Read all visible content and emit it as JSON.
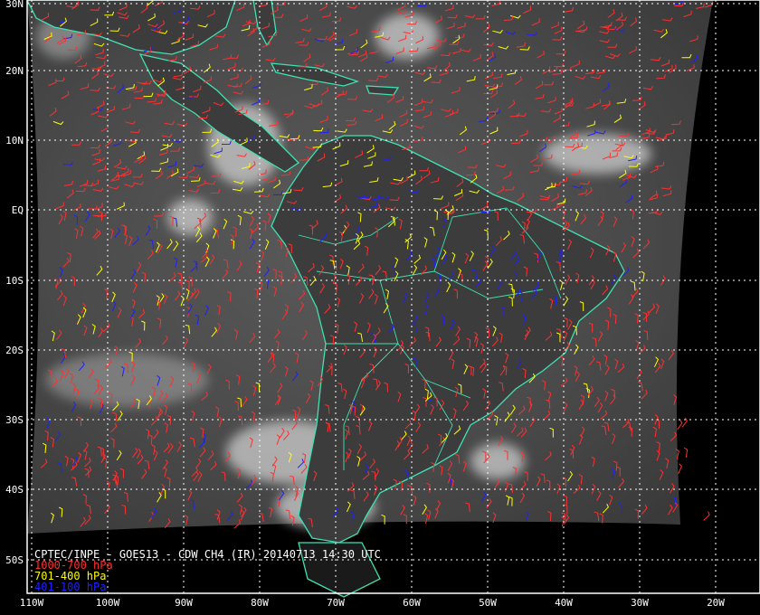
{
  "title": "CPTEC/INPE - GOES13 - CDW CH4 (IR) 20140713 14:30 UTC",
  "legend": [
    {
      "label": "1000-700 hPa",
      "color": "#ff3030"
    },
    {
      "label": "701-400 hPa",
      "color": "#ffff00"
    },
    {
      "label": "401-100 hPa",
      "color": "#2020ff"
    }
  ],
  "lat_labels": [
    "30N",
    "20N",
    "10N",
    "EQ",
    "10S",
    "20S",
    "30S",
    "40S",
    "50S"
  ],
  "lon_labels": [
    "110W",
    "100W",
    "90W",
    "80W",
    "70W",
    "60W",
    "50W",
    "40W",
    "30W",
    "20W"
  ],
  "colors": {
    "coastline": "#40e0b0",
    "grid": "#ffffff",
    "background": "#000000",
    "frame": "#ffffff"
  }
}
